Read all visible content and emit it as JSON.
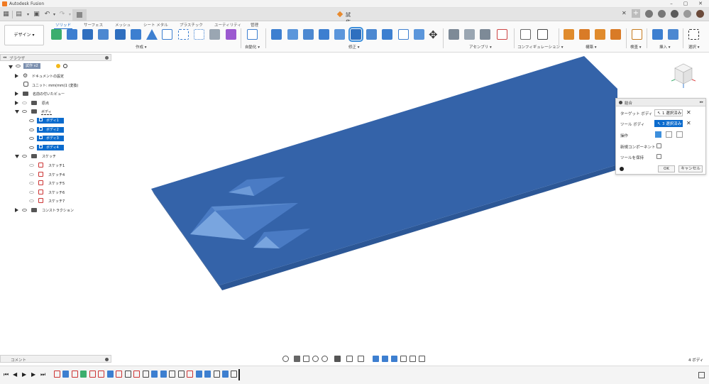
{
  "app": {
    "title": "Autodesk Fusion"
  },
  "document": {
    "tab_title": "試作 v2*"
  },
  "toolbar": {
    "workspace": "デザイン ▾",
    "tabs": [
      {
        "label": "ソリッド",
        "active": true
      },
      {
        "label": "サーフェス",
        "active": false
      },
      {
        "label": "メッシュ",
        "active": false
      },
      {
        "label": "シート メタル",
        "active": false
      },
      {
        "label": "プラスチック",
        "active": false
      },
      {
        "label": "ユーティリティ",
        "active": false
      },
      {
        "label": "管理",
        "active": false
      }
    ],
    "groups": {
      "create": "作成 ▾",
      "automate": "自動化 ▾",
      "modify": "修正 ▾",
      "assemble": "アセンブリ ▾",
      "configure": "コンフィギュレーション ▾",
      "construct": "構築 ▾",
      "inspect": "検査 ▾",
      "insert": "挿入 ▾",
      "select": "選択 ▾"
    }
  },
  "browser": {
    "header": "ブラウザ",
    "root": "試作 v2",
    "doc_settings": "ドキュメントの設定",
    "units": "ユニット: mm(mm)1 (変換)",
    "named_views": "名前の付いたビュー",
    "origin": "原点",
    "bodies_folder": "ボディ",
    "bodies": [
      "ボディ1",
      "ボディ2",
      "ボディ3",
      "ボディ4"
    ],
    "sketches_folder": "スケッチ",
    "sketches": [
      "スケッチ1",
      "スケッチ4",
      "スケッチ5",
      "スケッチ6",
      "スケッチ7"
    ],
    "construction": "コンストラクション"
  },
  "combine_dialog": {
    "title": "結合",
    "target_label": "ターゲット ボディ",
    "target_value": "1 選択済み",
    "tool_label": "ツール ボディ",
    "tool_value": "3 選択済み",
    "operation_label": "操作",
    "new_component_label": "新規コンポーネント",
    "keep_tools_label": "ツールを保持",
    "ok": "OK",
    "cancel": "キャンセル"
  },
  "comments": {
    "label": "コメント"
  },
  "status": {
    "selection": "4 ボディ"
  },
  "colors": {
    "body": "#3463a9",
    "body_dark": "#274f8a",
    "accent": "#0b6bcd"
  }
}
